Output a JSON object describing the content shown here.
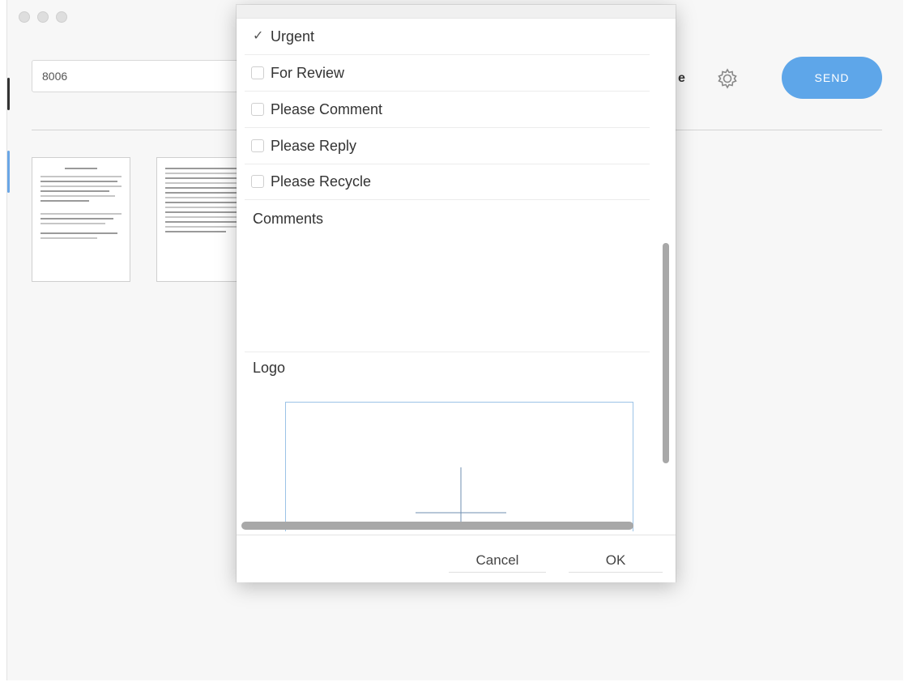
{
  "main": {
    "fax_number_value": "8006",
    "peek_label": "e",
    "send_label": "SEND",
    "settings_icon": "gear-icon"
  },
  "dialog": {
    "options": [
      {
        "label": "Urgent",
        "checked": true
      },
      {
        "label": "For Review",
        "checked": false
      },
      {
        "label": "Please Comment",
        "checked": false
      },
      {
        "label": "Please Reply",
        "checked": false
      },
      {
        "label": "Please Recycle",
        "checked": false
      }
    ],
    "comments_label": "Comments",
    "comments_value": "",
    "logo_label": "Logo",
    "cancel_label": "Cancel",
    "ok_label": "OK"
  },
  "colors": {
    "send_button": "#5ea6e9",
    "logo_border": "#9cc3e6"
  }
}
